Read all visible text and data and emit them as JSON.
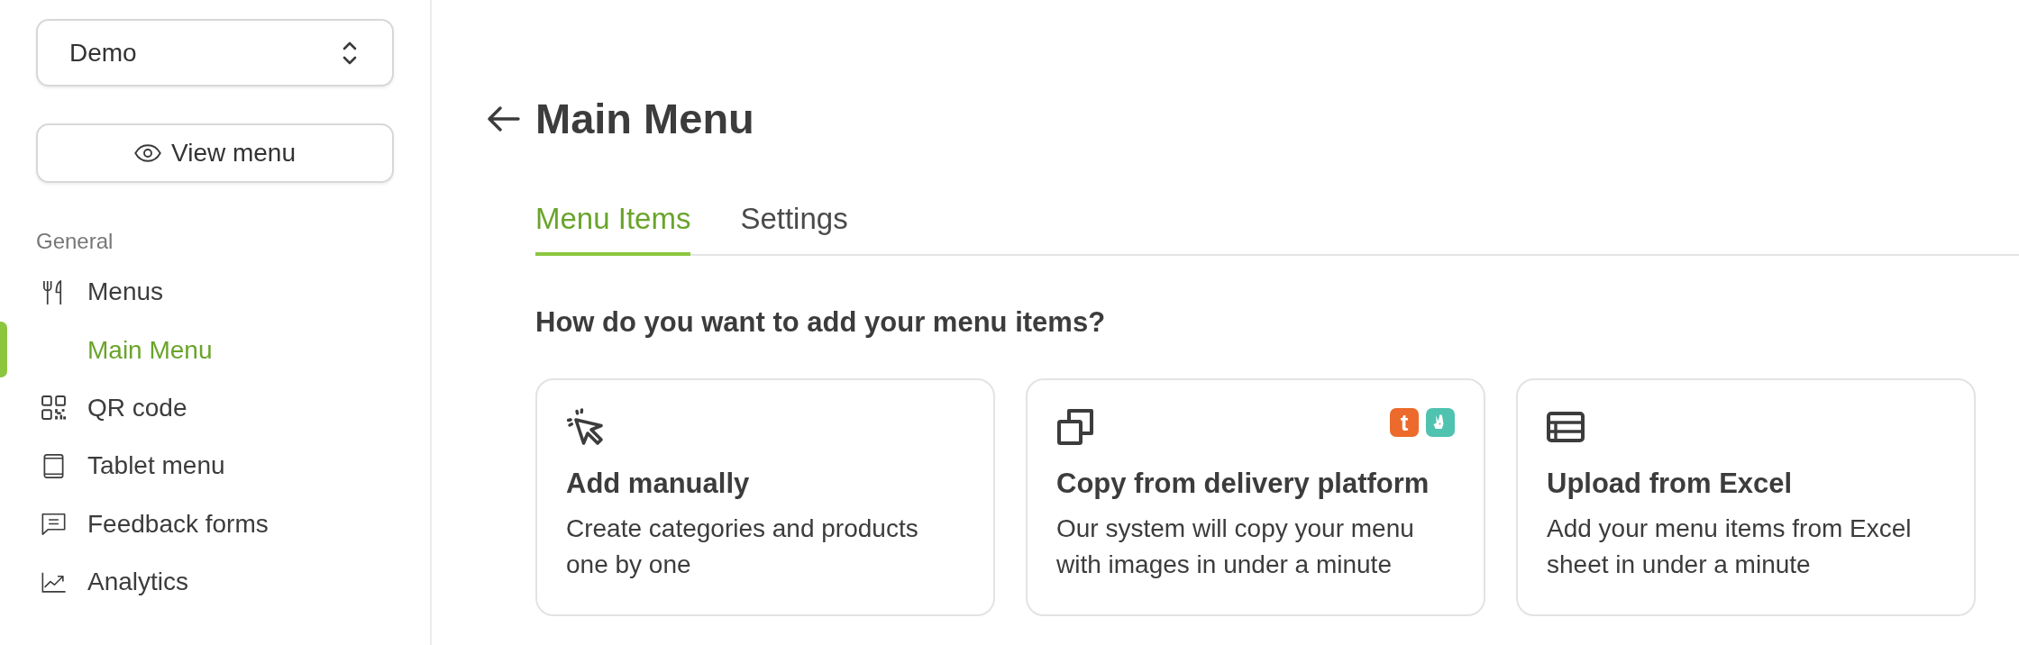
{
  "sidebar": {
    "dropdown": {
      "value": "Demo"
    },
    "view_button": {
      "label": "View menu"
    },
    "section_label": "General",
    "items": [
      {
        "kind": "menus",
        "label": "Menus",
        "selected": false,
        "children": [
          {
            "label": "Main Menu",
            "selected": true
          }
        ]
      },
      {
        "kind": "qr",
        "label": "QR code",
        "selected": false
      },
      {
        "kind": "tablet",
        "label": "Tablet menu",
        "selected": false
      },
      {
        "kind": "feedback",
        "label": "Feedback forms",
        "selected": false
      },
      {
        "kind": "analytics",
        "label": "Analytics",
        "selected": false
      }
    ]
  },
  "header": {
    "title": "Main Menu"
  },
  "tabs": [
    {
      "label": "Menu Items",
      "selected": true
    },
    {
      "label": "Settings",
      "selected": false
    }
  ],
  "question": "How do you want to add your menu items?",
  "options": [
    {
      "kind": "manual",
      "title": "Add manually",
      "description": "Create categories and products one by one"
    },
    {
      "kind": "copy",
      "title": "Copy from delivery platform",
      "description": "Our system will copy your menu with images in under a minute",
      "platforms": [
        {
          "kind": "letter",
          "label": "t",
          "color": "#ec6a2c"
        },
        {
          "kind": "logo",
          "color": "#50c2b0"
        }
      ]
    },
    {
      "kind": "excel",
      "title": "Upload from Excel",
      "description": "Add your menu items from Excel sheet in under a minute"
    }
  ]
}
